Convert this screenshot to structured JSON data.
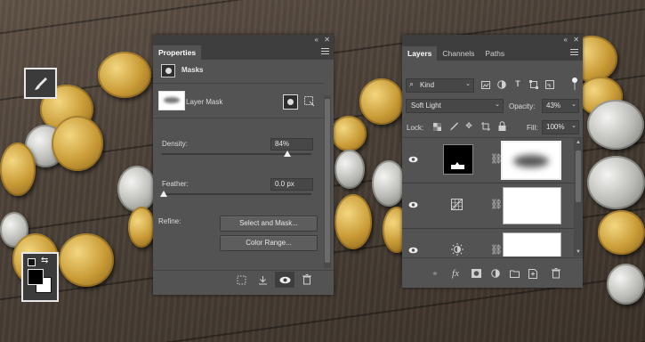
{
  "properties": {
    "title": "Properties",
    "section_title": "Masks",
    "layer_mask_label": "Layer Mask",
    "density_label": "Density:",
    "density_value": "84%",
    "density_level": 0.84,
    "feather_label": "Feather:",
    "feather_value": "0.0 px",
    "feather_level": 0.0,
    "refine_label": "Refine:",
    "select_and_mask_button": "Select and Mask...",
    "color_range_button": "Color Range..."
  },
  "layers": {
    "tabs": [
      "Layers",
      "Channels",
      "Paths"
    ],
    "active_tab": "Layers",
    "filter_kind": "Kind",
    "blend_mode": "Soft Light",
    "opacity_label": "Opacity:",
    "opacity_value": "43%",
    "lock_label": "Lock:",
    "fill_label": "Fill:",
    "fill_value": "100%",
    "rows": [
      {
        "type": "solid-color-fill",
        "mask": "blurred"
      },
      {
        "type": "gradient-map",
        "mask": "white"
      },
      {
        "type": "brightness-contrast",
        "mask": "white"
      }
    ]
  },
  "colors": {
    "panel_bg": "#535353",
    "panel_dark": "#3e3e3e",
    "highlight": "#f0f0f0"
  },
  "icons": {
    "brush_tool": "brush-icon",
    "swap_colors": "swap-colors-icon",
    "default_colors": "default-colors-icon"
  }
}
